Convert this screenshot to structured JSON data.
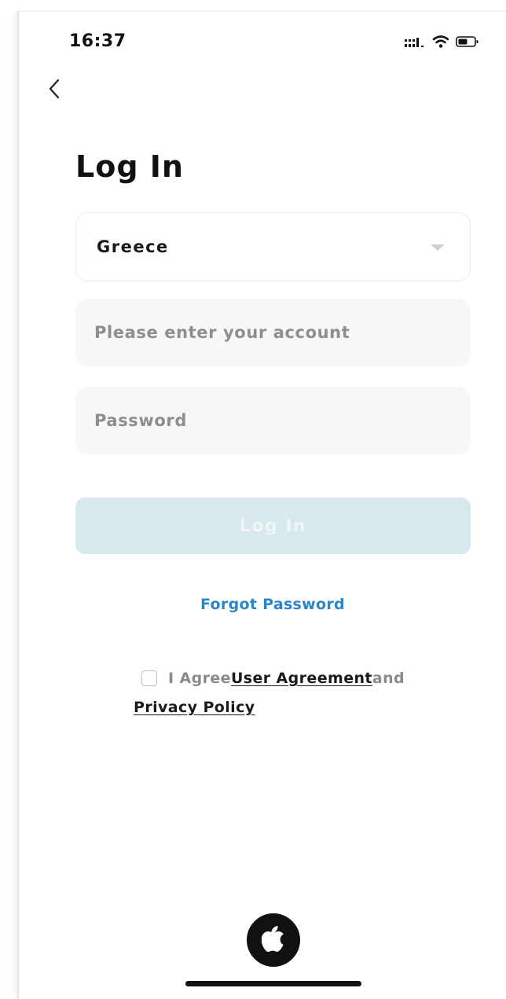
{
  "status_bar": {
    "time": "16:37",
    "icons": [
      "signal-icon",
      "wifi-icon",
      "battery-icon"
    ]
  },
  "nav": {
    "back_icon": "chevron-left-icon"
  },
  "page": {
    "title": "Log In"
  },
  "form": {
    "country": {
      "value": "Greece",
      "icon": "chevron-down-icon"
    },
    "account": {
      "value": "",
      "placeholder": "Please enter your account"
    },
    "password": {
      "value": "",
      "placeholder": "Password"
    },
    "login_label": "Log In",
    "forgot_label": "Forgot Password"
  },
  "agreement": {
    "checked": false,
    "prefix": "I Agree",
    "user_agreement": "User Agreement",
    "conjunction": "and",
    "privacy_policy": "Privacy Policy"
  },
  "social": {
    "apple_icon": "apple-icon"
  },
  "colors": {
    "accent": "#2a86c8",
    "button_disabled": "#d8e9ee",
    "input_bg": "#f7f7f7"
  }
}
